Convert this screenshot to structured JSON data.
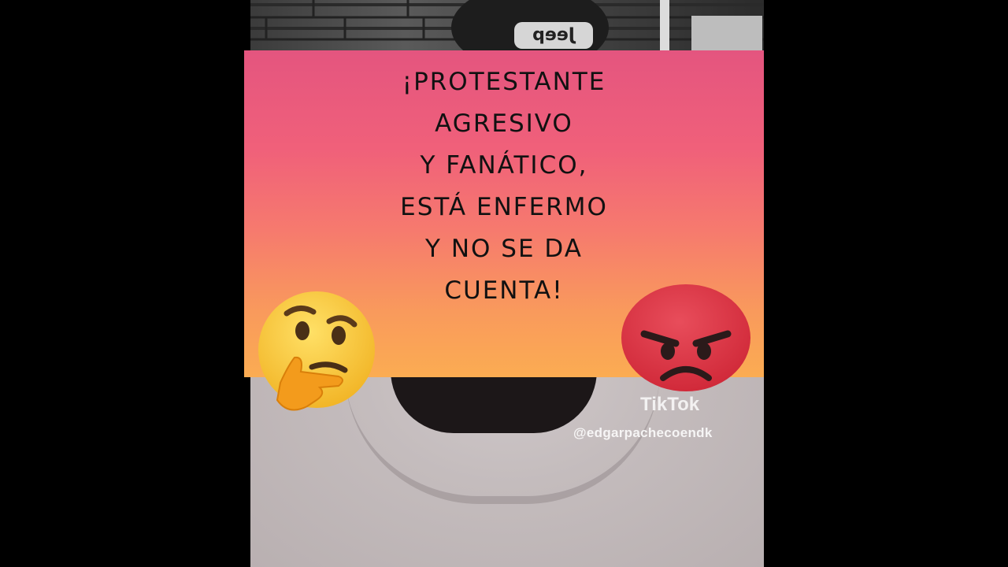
{
  "caption": {
    "lines": [
      "¡Protestante",
      "agresivo",
      "y fanático,",
      "está enfermo",
      "y no se da",
      "cuenta!"
    ]
  },
  "background_video": {
    "cap_logo": "Jeep",
    "watermark_app": "TikTok",
    "watermark_handle": "@edgarpachecoendk"
  },
  "emojis": {
    "left": "thinking-face",
    "right": "angry-face"
  },
  "colors": {
    "banner_top": "#e4557f",
    "banner_bottom": "#fbac52",
    "angry": "#d83145",
    "thinking": "#f7c23b"
  }
}
